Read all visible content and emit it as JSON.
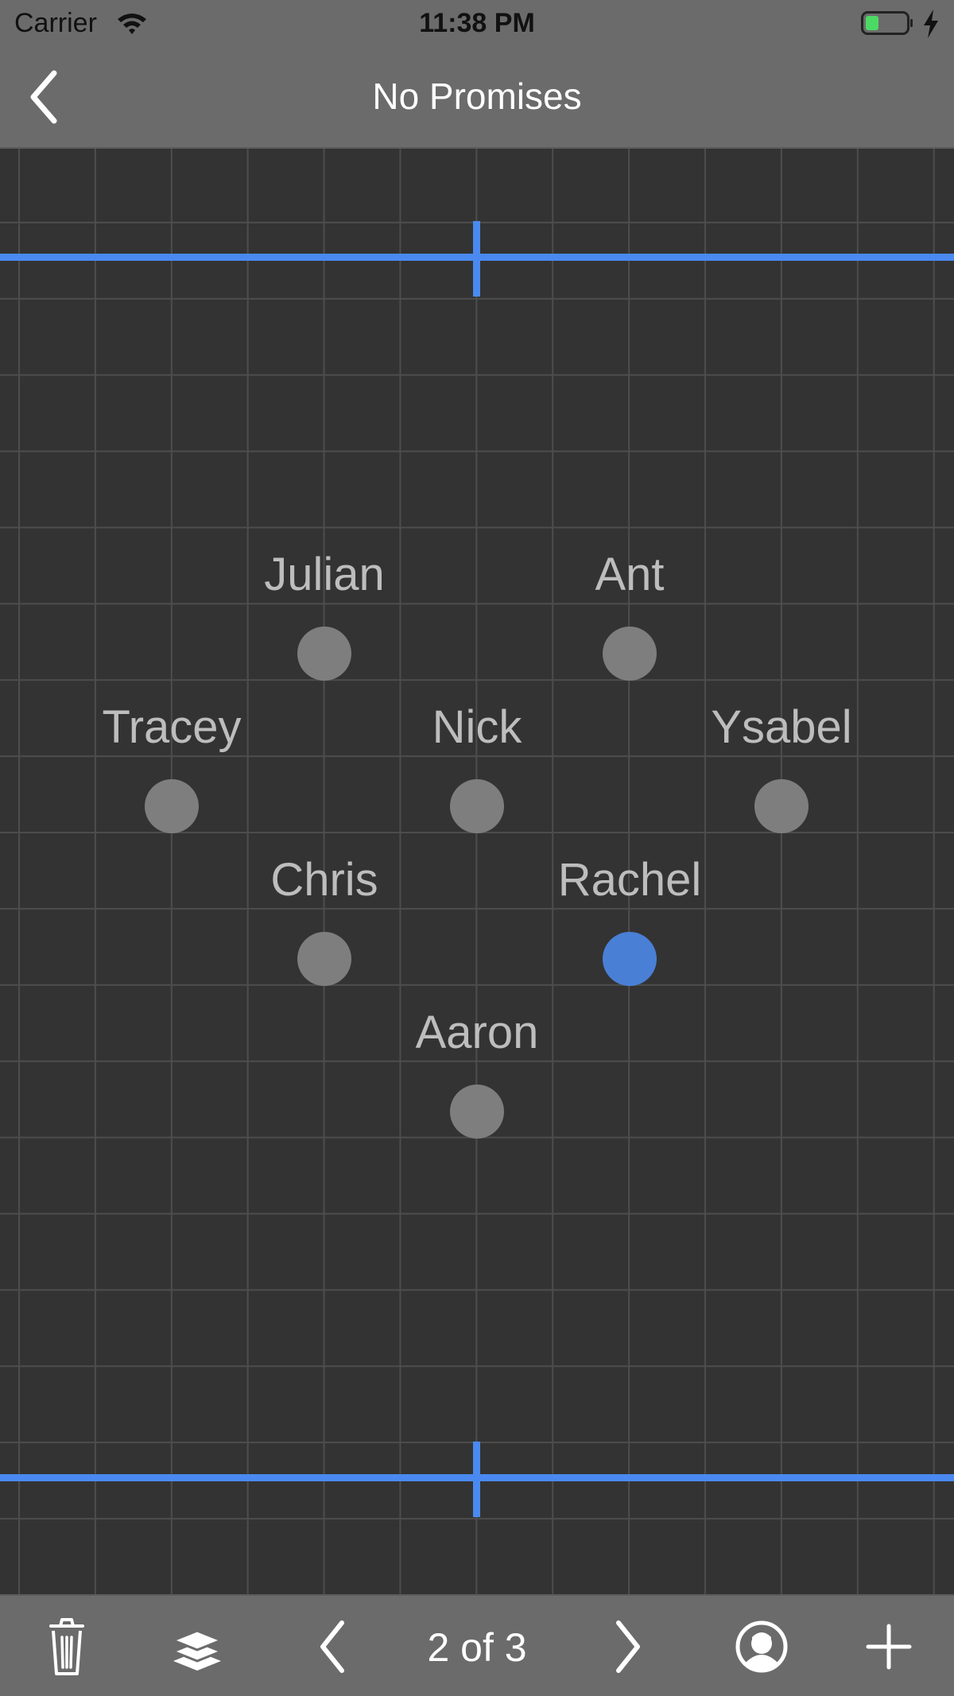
{
  "status_bar": {
    "carrier": "Carrier",
    "time": "11:38 PM",
    "battery_color": "#4cd964"
  },
  "nav": {
    "title": "No Promises",
    "back_icon": "chevron-left-icon"
  },
  "canvas": {
    "grid_color": "#4d4d4d",
    "background_color": "#333333",
    "marker_color": "#4a8af0",
    "people": [
      {
        "name": "Julian",
        "selected": false
      },
      {
        "name": "Ant",
        "selected": false
      },
      {
        "name": "Tracey",
        "selected": false
      },
      {
        "name": "Nick",
        "selected": false
      },
      {
        "name": "Ysabel",
        "selected": false
      },
      {
        "name": "Chris",
        "selected": false
      },
      {
        "name": "Rachel",
        "selected": true
      },
      {
        "name": "Aaron",
        "selected": false
      }
    ]
  },
  "toolbar": {
    "page_indicator": "2 of 3",
    "icons": [
      "trash-icon",
      "layers-icon",
      "chevron-left-icon",
      "chevron-right-icon",
      "person-icon",
      "plus-icon"
    ]
  }
}
